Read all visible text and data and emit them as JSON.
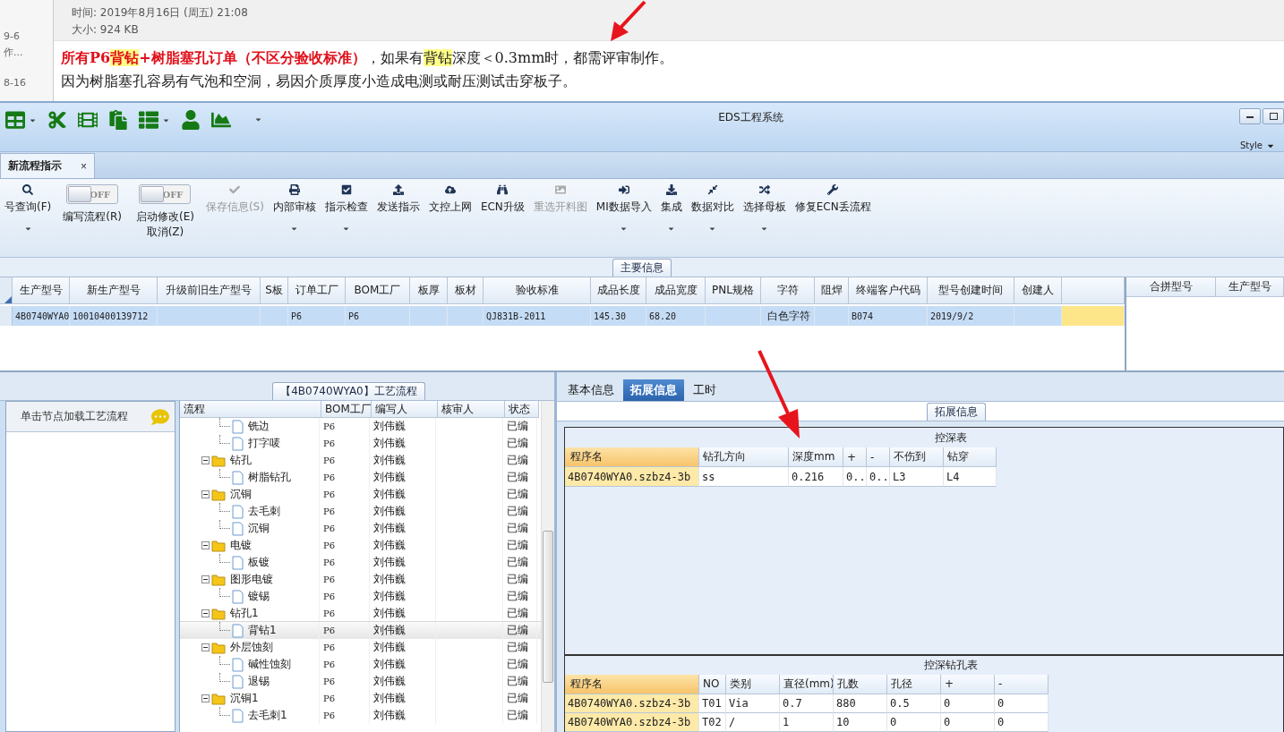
{
  "email": {
    "list_items": [
      "9-6",
      "作...",
      "8-16"
    ],
    "time": "时间: 2019年8月16日 (周五) 21:08",
    "size": "大小: 924 KB",
    "lines": [
      [
        {
          "kind": "emphasis",
          "text": "所有P6"
        },
        {
          "kind": "emphasis-highlight",
          "text": "背钻"
        },
        {
          "kind": "emphasis",
          "text": "+树脂塞孔订单（不区分验收标准）"
        },
        {
          "kind": "plain",
          "text": "，如果有"
        },
        {
          "kind": "highlight",
          "text": "背钻"
        },
        {
          "kind": "plain",
          "text": "深度＜0.3mm时，都需评审制作。"
        }
      ],
      [
        {
          "kind": "plain",
          "text": "因为树脂塞孔容易有气泡和空洞，易因介质厚度小造成电测或耐压测试击穿板子。"
        }
      ]
    ]
  },
  "window": {
    "title": "EDS工程系统",
    "style_menu": "Style"
  },
  "doc_tabs": [
    {
      "label": "新流程指示",
      "selected": true,
      "close": "×"
    }
  ],
  "ribbon": [
    {
      "kind": "button",
      "label": "号查询(F)",
      "disabled": false,
      "dropdown": true
    },
    {
      "kind": "toggle",
      "label": "编写流程(R)",
      "switch_text": "OFF",
      "on": false
    },
    {
      "kind": "toggle",
      "label": "启动修改(E)\n取消(Z)",
      "switch_text": "OFF",
      "on": false
    },
    {
      "kind": "button",
      "label": "保存信息(S)",
      "disabled": true,
      "dropdown": false
    },
    {
      "kind": "button",
      "label": "内部审核",
      "disabled": false,
      "dropdown": true
    },
    {
      "kind": "button",
      "label": "指示检查",
      "disabled": false,
      "dropdown": true
    },
    {
      "kind": "button",
      "label": "发送指示",
      "disabled": false,
      "dropdown": false
    },
    {
      "kind": "button",
      "label": "文控上网",
      "disabled": false,
      "dropdown": false
    },
    {
      "kind": "button",
      "label": "ECN升级",
      "disabled": false,
      "dropdown": false
    },
    {
      "kind": "button",
      "label": "重选开料图",
      "disabled": true,
      "dropdown": false
    },
    {
      "kind": "button",
      "label": "MI数据导入",
      "disabled": false,
      "dropdown": true
    },
    {
      "kind": "button",
      "label": "集成",
      "disabled": false,
      "dropdown": true
    },
    {
      "kind": "button",
      "label": "数据对比",
      "disabled": false,
      "dropdown": true
    },
    {
      "kind": "button",
      "label": "选择母板",
      "disabled": false,
      "dropdown": true
    },
    {
      "kind": "button",
      "label": "修复ECN丢流程",
      "disabled": false,
      "dropdown": false
    }
  ],
  "main_info": {
    "title": "主要信息",
    "columns": [
      "生产型号",
      "新生产型号",
      "升级前旧生产型号",
      "S板",
      "订单工厂",
      "BOM工厂",
      "板厚",
      "板材",
      "验收标准",
      "成品长度",
      "成品宽度",
      "PNL规格",
      "字符",
      "阻焊",
      "终端客户代码",
      "型号创建时间",
      "创建人"
    ],
    "rows": [
      {
        "selected": true,
        "cells": [
          "4B0740WYA0",
          "10010400139712",
          null,
          null,
          "P6",
          "P6",
          null,
          null,
          "QJ831B-2011",
          "145.30",
          "68.20",
          null,
          "白色字符",
          null,
          "B074",
          "2019/9/2",
          null
        ]
      }
    ],
    "side_columns": [
      "合拼型号",
      "生产型号"
    ]
  },
  "node_panel": {
    "hint": "单击节点加载工艺流程"
  },
  "process_tree": {
    "title": "【4B0740WYA0】工艺流程",
    "columns": [
      "流程",
      "BOM工厂",
      "编写人",
      "核审人",
      "状态"
    ],
    "nodes": [
      {
        "kind": "file",
        "label": "铣边",
        "bom": "P6",
        "writer": "刘伟巍",
        "status": "已编",
        "selected": false
      },
      {
        "kind": "file",
        "label": "打字唛",
        "bom": "P6",
        "writer": "刘伟巍",
        "status": "已编",
        "selected": false
      },
      {
        "kind": "folder",
        "label": "钻孔",
        "bom": "P6",
        "writer": "刘伟巍",
        "status": "已编",
        "selected": false,
        "expanded": true,
        "children": [
          {
            "kind": "file",
            "label": "树脂钻孔",
            "bom": "P6",
            "writer": "刘伟巍",
            "status": "已编",
            "selected": false
          }
        ]
      },
      {
        "kind": "folder",
        "label": "沉铜",
        "bom": "P6",
        "writer": "刘伟巍",
        "status": "已编",
        "selected": false,
        "expanded": true,
        "children": [
          {
            "kind": "file",
            "label": "去毛刺",
            "bom": "P6",
            "writer": "刘伟巍",
            "status": "已编",
            "selected": false
          },
          {
            "kind": "file",
            "label": "沉铜",
            "bom": "P6",
            "writer": "刘伟巍",
            "status": "已编",
            "selected": false
          }
        ]
      },
      {
        "kind": "folder",
        "label": "电镀",
        "bom": "P6",
        "writer": "刘伟巍",
        "status": "已编",
        "selected": false,
        "expanded": true,
        "children": [
          {
            "kind": "file",
            "label": "板镀",
            "bom": "P6",
            "writer": "刘伟巍",
            "status": "已编",
            "selected": false
          }
        ]
      },
      {
        "kind": "folder",
        "label": "图形电镀",
        "bom": "P6",
        "writer": "刘伟巍",
        "status": "已编",
        "selected": false,
        "expanded": true,
        "children": [
          {
            "kind": "file",
            "label": "镀锡",
            "bom": "P6",
            "writer": "刘伟巍",
            "status": "已编",
            "selected": false
          }
        ]
      },
      {
        "kind": "folder",
        "label": "钻孔1",
        "bom": "P6",
        "writer": "刘伟巍",
        "status": "已编",
        "selected": false,
        "expanded": true,
        "children": [
          {
            "kind": "file",
            "label": "背钻1",
            "bom": "P6",
            "writer": "刘伟巍",
            "status": "已编",
            "selected": true
          }
        ]
      },
      {
        "kind": "folder",
        "label": "外层蚀刻",
        "bom": "P6",
        "writer": "刘伟巍",
        "status": "已编",
        "selected": false,
        "expanded": true,
        "children": [
          {
            "kind": "file",
            "label": "碱性蚀刻",
            "bom": "P6",
            "writer": "刘伟巍",
            "status": "已编",
            "selected": false
          },
          {
            "kind": "file",
            "label": "退锡",
            "bom": "P6",
            "writer": "刘伟巍",
            "status": "已编",
            "selected": false
          }
        ]
      },
      {
        "kind": "folder",
        "label": "沉铜1",
        "bom": "P6",
        "writer": "刘伟巍",
        "status": "已编",
        "selected": false,
        "expanded": true,
        "children": [
          {
            "kind": "file",
            "label": "去毛刺1",
            "bom": "P6",
            "writer": "刘伟巍",
            "status": "已编",
            "selected": false
          }
        ]
      }
    ]
  },
  "detail_tabs": [
    {
      "label": "基本信息",
      "selected": false
    },
    {
      "label": "拓展信息",
      "selected": true
    },
    {
      "label": "工时",
      "selected": false
    }
  ],
  "detail_group": "拓展信息",
  "depth_table": {
    "title": "控深表",
    "columns": [
      "程序名",
      "钻孔方向",
      "深度mm",
      "+",
      "-",
      "不伤到",
      "钻穿"
    ],
    "rows": [
      [
        "4B0740WYA0.szbz4-3b",
        "ss",
        "0.216",
        "0..",
        "0..",
        "L3",
        "L4"
      ]
    ]
  },
  "drill_table": {
    "title": "控深钻孔表",
    "columns": [
      "程序名",
      "NO",
      "类别",
      "直径(mm)",
      "孔数",
      "孔径",
      "+",
      "-"
    ],
    "rows": [
      [
        "4B0740WYA0.szbz4-3b",
        "T01",
        "Via",
        "0.7",
        "880",
        "0.5",
        "0",
        "0"
      ],
      [
        "4B0740WYA0.szbz4-3b",
        "T02",
        "/",
        "1",
        "10",
        "0",
        "0",
        "0"
      ]
    ]
  }
}
